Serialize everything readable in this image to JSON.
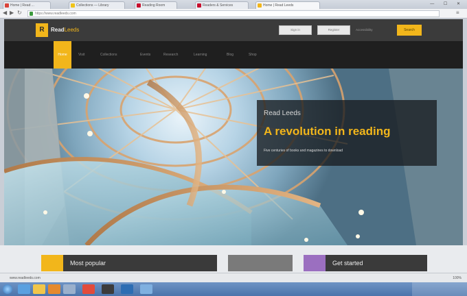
{
  "browser": {
    "tabs": [
      {
        "label": "Home | Read ...",
        "favicon_color": "#d9443b"
      },
      {
        "label": "Collections — Library",
        "favicon_color": "#f0c419"
      },
      {
        "label": "Reading Room",
        "favicon_color": "#c8102e"
      },
      {
        "label": "Readers & Services",
        "favicon_color": "#c8102e"
      },
      {
        "label": "Home | Read Leeds",
        "favicon_color": "#f2b61b",
        "active": true
      }
    ],
    "window_controls": "— ☐ ✕",
    "url": "https://www.readleeds.com"
  },
  "header": {
    "logo_mark": "R",
    "logo_name": "Read",
    "logo_accent": "Leeds",
    "buttons": [
      "Sign in",
      "Register"
    ],
    "link": "Accessibility",
    "search_label": "Search"
  },
  "nav": {
    "items": [
      "Home",
      "Visit",
      "Collections",
      "Events",
      "Research",
      "Learning",
      "Blog",
      "Shop"
    ]
  },
  "hero": {
    "kicker": "Read Leeds",
    "title": "A revolution in reading",
    "subtitle": "Five centuries of books and magazines to download"
  },
  "tiles": [
    {
      "label": "Most popular",
      "accent": "#f2b61b"
    },
    {
      "label": "",
      "accent": "#7a7a7a"
    },
    {
      "label": "Get started",
      "accent": "#9b6fc0"
    }
  ],
  "status": {
    "text": "www.readleeds.com",
    "zoom": "100%"
  },
  "colors": {
    "brand_yellow": "#f2b61b",
    "header_dark": "#3b3b3b",
    "nav_dark": "#1f1f1f"
  }
}
